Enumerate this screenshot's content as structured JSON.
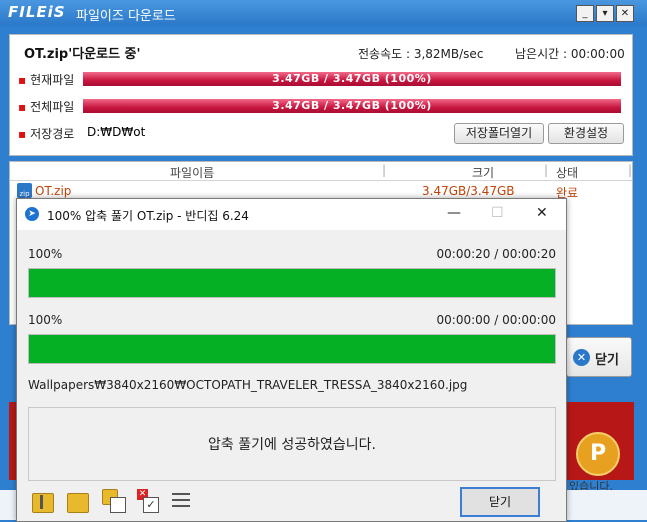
{
  "app": {
    "logo": "FILEiS",
    "title": "파일이즈 다운로드"
  },
  "window_buttons": {
    "minimize": "_",
    "restore": "▾",
    "close": "✕"
  },
  "download": {
    "file_heading": "OT.zip'다운로드 중'",
    "speed": "전송속도 : 3,82MB/sec",
    "remaining": "남은시간 : 00:00:00",
    "current_label": "현재파일",
    "current_progress": "3.47GB / 3.47GB (100%)",
    "current_fraction": 1.0,
    "total_label": "전체파일",
    "total_progress": "3.47GB / 3.47GB (100%)",
    "total_fraction": 1.0,
    "path_label": "저장경로",
    "path_value": "D:₩D₩ot",
    "open_folder_button": "저장폴더열기",
    "settings_button": "환경설정"
  },
  "file_list": {
    "columns": [
      "파일이름",
      "크기",
      "상태"
    ],
    "rows": [
      {
        "name": "OT.zip",
        "size": "3.47GB/3.47GB",
        "status": "완료"
      }
    ]
  },
  "close_button": "닫기",
  "ad_partial_text": "있습니다.",
  "ad_coin_symbol": "P",
  "dialog": {
    "title": "100% 압축 풀기 OT.zip - 반디집 6.24",
    "file_percent": "100%",
    "file_time": "00:00:20 / 00:00:20",
    "file_fraction": 1.0,
    "total_percent": "100%",
    "total_time": "00:00:00 / 00:00:00",
    "total_fraction": 1.0,
    "current_path": "Wallpapers₩3840x2160₩OCTOPATH_TRAVELER_TRESSA_3840x2160.jpg",
    "message": "압축 풀기에 성공하였습니다.",
    "close_button": "닫기",
    "window_buttons": {
      "minimize": "—",
      "maximize": "☐",
      "close": "✕"
    }
  },
  "colors": {
    "accent": "#2a78c8",
    "progress_red": "#c8163f",
    "progress_green": "#06b025",
    "status_orange": "#c0440a"
  }
}
